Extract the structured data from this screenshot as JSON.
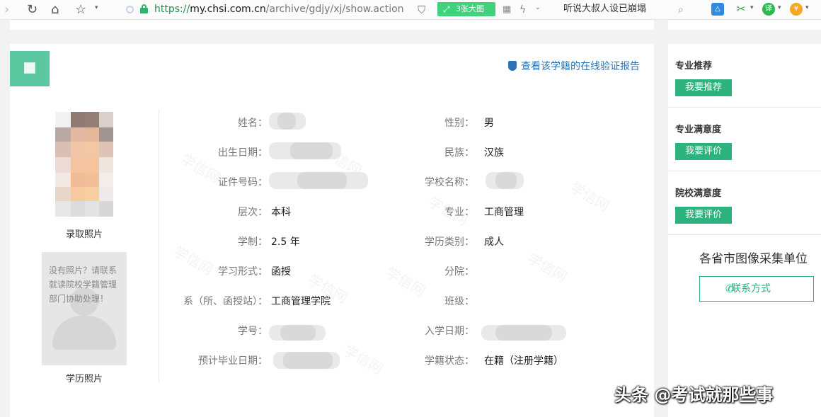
{
  "browser": {
    "url_protocol": "https://",
    "url_domain": "my.chsi.com.cn",
    "url_path": "/archive/gdjy/xj/show.action",
    "bigimg_label": "3张大图",
    "search_text": "听说大叔人设已崩塌",
    "ext_labels": [
      "译",
      "¥"
    ]
  },
  "main": {
    "verify_link": "查看该学籍的在线验证报告",
    "admission_photo_label": "录取照片",
    "no_photo_msg": "没有照片？请联系就读院校学籍管理部门协助处理！",
    "education_photo_label": "学历照片",
    "watermark": "学信网",
    "left_fields": [
      {
        "label": "姓名：",
        "value": ""
      },
      {
        "label": "出生日期：",
        "value": ""
      },
      {
        "label": "证件号码：",
        "value": ""
      },
      {
        "label": "层次：",
        "value": "本科"
      },
      {
        "label": "学制：",
        "value": "2.5 年"
      },
      {
        "label": "学习形式：",
        "value": "函授"
      },
      {
        "label": "系（所、函授站）：",
        "value": "工商管理学院"
      },
      {
        "label": "学号：",
        "value": ""
      },
      {
        "label": "预计毕业日期：",
        "value": ""
      }
    ],
    "right_fields": [
      {
        "label": "性别：",
        "value": "男"
      },
      {
        "label": "民族：",
        "value": "汉族"
      },
      {
        "label": "学校名称：",
        "value": ""
      },
      {
        "label": "专业：",
        "value": "工商管理"
      },
      {
        "label": "学历类别：",
        "value": "成人"
      },
      {
        "label": "分院：",
        "value": ""
      },
      {
        "label": "班级：",
        "value": ""
      },
      {
        "label": "入学日期：",
        "value": ""
      },
      {
        "label": "学籍状态：",
        "value": "在籍（注册学籍）"
      }
    ]
  },
  "sidebar": {
    "sections": [
      {
        "title": "专业推荐",
        "button": "我要推荐"
      },
      {
        "title": "专业满意度",
        "button": "我要评价"
      },
      {
        "title": "院校满意度",
        "button": "我要评价"
      }
    ],
    "heading": "各省市图像采集单位",
    "contact_button": "联系方式"
  },
  "overlay": {
    "text": "头条 @考试就那些事"
  },
  "colors": {
    "accent_green": "#2cb27c",
    "logo_green": "#5ac7a0",
    "link_blue": "#2a74b8"
  }
}
